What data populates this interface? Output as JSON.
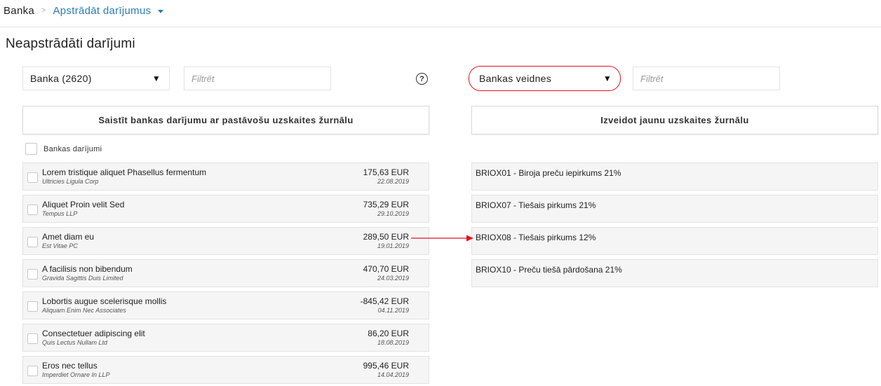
{
  "breadcrumb": {
    "root": "Banka",
    "separator": ">",
    "current": "Apstrādāt darījumus"
  },
  "page": {
    "title": "Neapstrādāti darījumi"
  },
  "left_panel": {
    "select_value": "Banka (2620)",
    "filter_placeholder": "Filtrēt",
    "action_label": "Saistīt bankas darījumu ar pastāvošu uzskaites žurnālu",
    "select_all_label": "Bankas darījumi",
    "transactions": [
      {
        "name": "Lorem tristique aliquet Phasellus fermentum",
        "company": "Ultricies Ligula Corp",
        "amount": "175,63 EUR",
        "date": "22.08.2019"
      },
      {
        "name": "Aliquet Proin velit Sed",
        "company": "Tempus LLP",
        "amount": "735,29 EUR",
        "date": "29.10.2019"
      },
      {
        "name": "Amet diam eu",
        "company": "Est Vitae PC",
        "amount": "289,50 EUR",
        "date": "19.01.2019"
      },
      {
        "name": "A facilisis non bibendum",
        "company": "Gravida Sagittis Duis Limited",
        "amount": "470,70 EUR",
        "date": "24.03.2019"
      },
      {
        "name": "Lobortis augue scelerisque mollis",
        "company": "Aliquam Enim Nec Associates",
        "amount": "-845,42 EUR",
        "date": "04.11.2019"
      },
      {
        "name": "Consectetuer adipiscing elit",
        "company": "Quis Lectus Nullam Ltd",
        "amount": "86,20 EUR",
        "date": "18.08.2019"
      },
      {
        "name": "Eros nec tellus",
        "company": "Imperdiet Ornare In LLP",
        "amount": "995,46 EUR",
        "date": "14.04.2019"
      }
    ]
  },
  "right_panel": {
    "select_value": "Bankas veidnes",
    "filter_placeholder": "Filtrēt",
    "action_label": "Izveidot jaunu uzskaites žurnālu",
    "templates": [
      {
        "label": "BRIOX01 - Biroja preču iepirkums 21%"
      },
      {
        "label": "BRIOX07 - Tiešais pirkums 21%"
      },
      {
        "label": "BRIOX08 - Tiešais pirkums 12%"
      },
      {
        "label": "BRIOX10 - Preču tiešā pārdošana 21%"
      }
    ]
  },
  "icons": {
    "help": "help-circle-icon",
    "dropdown": "caret-down-icon",
    "link_arrow": "arrow-right-icon"
  },
  "colors": {
    "link": "#2b7bb9",
    "highlight": "#e0141e",
    "row_bg": "#f5f5f5"
  }
}
